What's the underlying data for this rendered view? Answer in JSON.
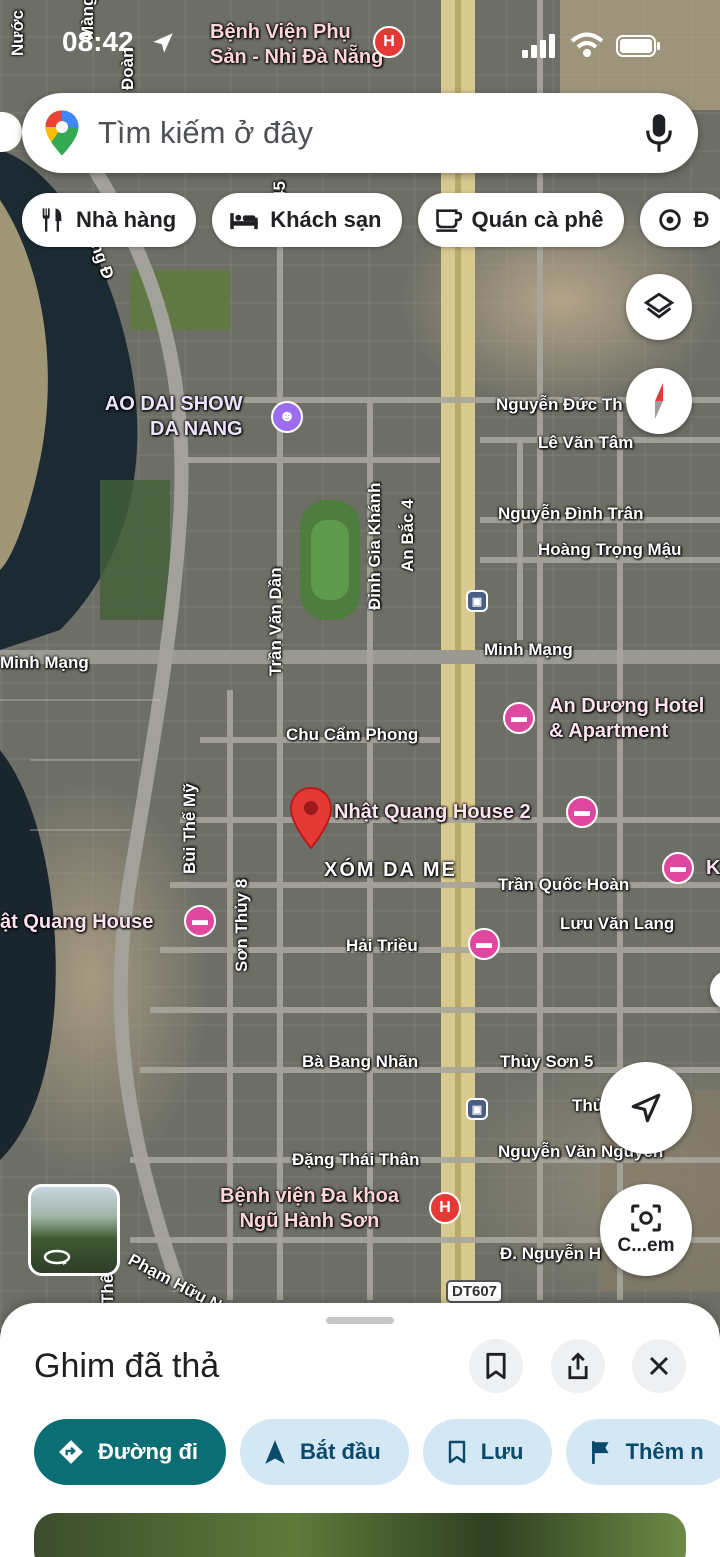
{
  "status_bar": {
    "time": "08:42"
  },
  "search": {
    "placeholder": "Tìm kiếm ở đây"
  },
  "chips": [
    {
      "label": "Nhà hàng",
      "icon": "fork-knife-icon"
    },
    {
      "label": "Khách sạn",
      "icon": "bed-icon"
    },
    {
      "label": "Quán cà phê",
      "icon": "coffee-cup-icon"
    },
    {
      "label": "Đ",
      "icon": "gas-station-icon"
    }
  ],
  "map": {
    "top_left_fragments": [
      "Nước",
      "Màng",
      "Đoàn"
    ],
    "roads": {
      "minh_mang_west": "Minh Mạng",
      "minh_mang_east": "Minh Mạng",
      "nguyen_duc_thu": "Nguyễn Đức Th",
      "le_van_tam": "Lê Văn Tâm",
      "nguyen_dinh_tran": "Nguyễn Đình Trân",
      "hoang_trong_mau": "Hoàng Trọng Mậu",
      "chu_cam_phong": "Chu Cẩm Phong",
      "tran_quoc_hoan": "Trần Quốc Hoàn",
      "luu_van_lang": "Lưu Văn Lang",
      "hai_trieu": "Hải Triều",
      "ba_bang_nhan": "Bà Bang Nhãn",
      "thuy_son_5": "Thủy Sơn 5",
      "thu": "Thủ",
      "dang_thai_than": "Đặng Thái Thân",
      "nguyen_van_nguyen": "Nguyễn Văn Nguyễn",
      "d_nguyen": "Đ. Nguyễn H",
      "pham_huu": "Phạm Hữu N",
      "tran_van_dan": "Trần Văn Dần",
      "dinh_gia_khanh": "Đinh Gia Khánh",
      "an_bac_4": "An Bắc 4",
      "bui_the_my": "Bùi Thế Mỹ",
      "son_thuy_8": "Sơn Thủy 8",
      "the": "Thế",
      "sonh_d": "ông Đ",
      "r45": "45"
    },
    "neighborhood": "XÓM DA ME",
    "route_shield": "DT607",
    "pois": {
      "hospital_phu_san": [
        "Bệnh Viện Phụ",
        "Sản - Nhi Đà Nẵng"
      ],
      "ao_dai_show": [
        "AO DAI SHOW",
        "DA NANG"
      ],
      "an_duong_hotel": [
        "An Dương Hotel",
        "& Apartment"
      ],
      "nhat_quang_house_2": "Nhật Quang House 2",
      "nhat_quang_house": "ật Quang House",
      "hospital_ngu_hanh_son": [
        "Bệnh viện Đa khoa",
        "Ngũ Hành Sơn"
      ],
      "k_fragment": "K"
    }
  },
  "camera_button": {
    "label": "C...em"
  },
  "sheet": {
    "title": "Ghim đã thả",
    "actions": [
      {
        "label": "Đường đi",
        "icon": "directions-diamond-icon"
      },
      {
        "label": "Bắt đầu",
        "icon": "navigation-arrow-icon"
      },
      {
        "label": "Lưu",
        "icon": "bookmark-icon"
      },
      {
        "label": "Thêm n",
        "icon": "flag-icon"
      }
    ]
  },
  "colors": {
    "pin_red": "#e53935",
    "hotel_pink": "#e0479e",
    "primary_teal": "#0b6e74",
    "chip_blue": "#d3e7f5"
  }
}
